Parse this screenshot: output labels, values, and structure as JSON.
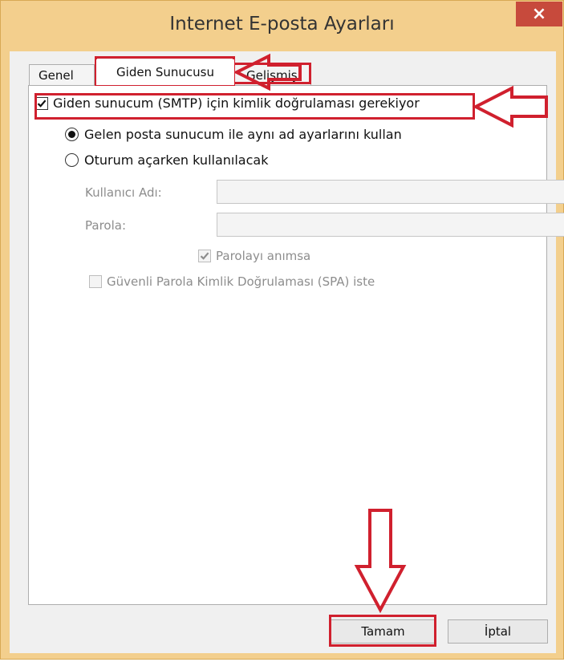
{
  "window": {
    "title": "Internet E-posta Ayarları",
    "close_label": "×"
  },
  "tabs": [
    {
      "label": "Genel",
      "selected": false
    },
    {
      "label": "Giden Sunucusu",
      "selected": true
    },
    {
      "label": "Gelişmiş",
      "selected": false
    }
  ],
  "outgoing": {
    "auth_required": {
      "label": "Giden sunucum (SMTP) için kimlik doğrulaması gerekiyor",
      "checked": true
    },
    "use_same_settings": {
      "label": "Gelen posta sunucum ile aynı ad ayarlarını kullan",
      "selected": true
    },
    "logon_using": {
      "label": "Oturum açarken kullanılacak",
      "selected": false
    },
    "username": {
      "label": "Kullanıcı Adı:",
      "value": ""
    },
    "password": {
      "label": "Parola:",
      "value": ""
    },
    "remember_password": {
      "label": "Parolayı anımsa",
      "checked": true,
      "disabled": true
    },
    "spa": {
      "label": "Güvenli Parola Kimlik Doğrulaması (SPA) iste",
      "checked": false,
      "disabled": true
    }
  },
  "buttons": {
    "ok": "Tamam",
    "cancel": "İptal"
  },
  "colors": {
    "frame": "#f3cf8d",
    "annotation_red": "#d0202e",
    "close_button": "#c74a3c"
  }
}
